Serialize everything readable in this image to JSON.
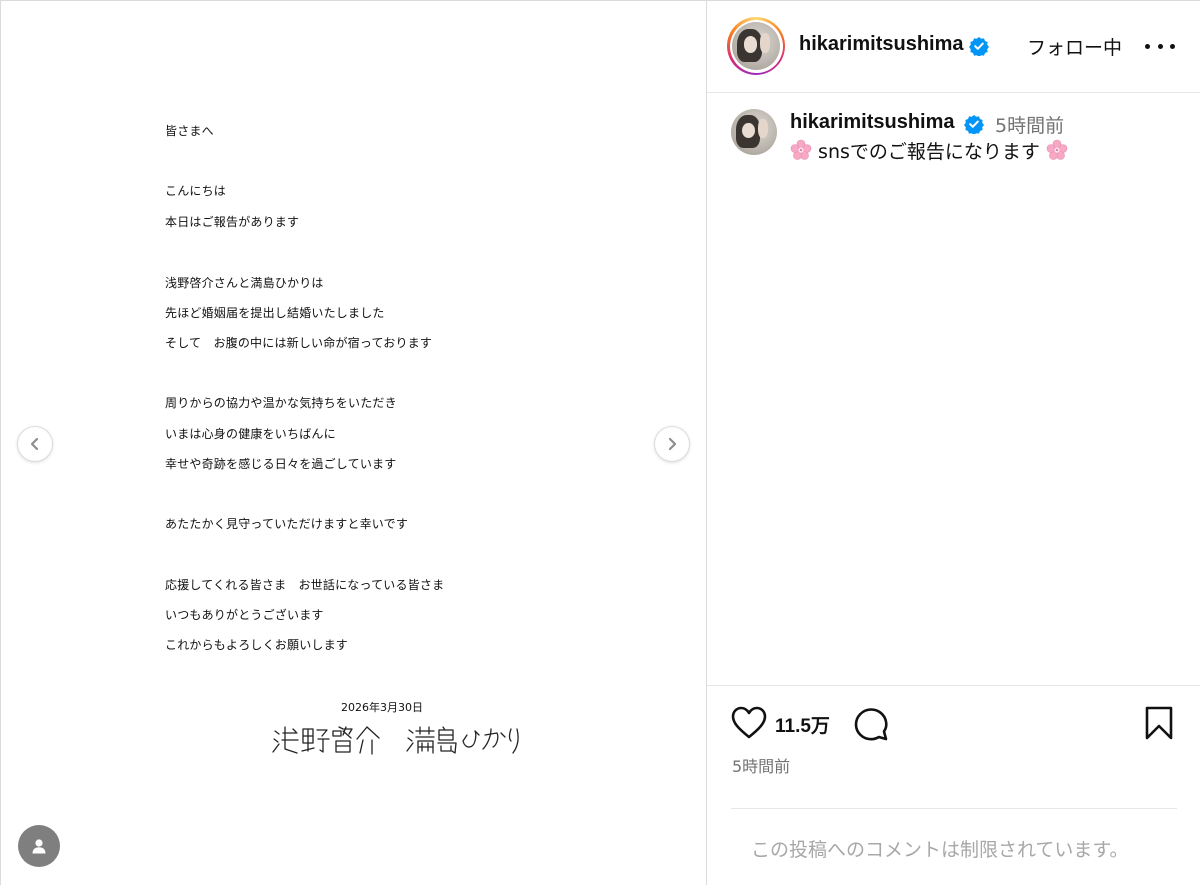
{
  "post": {
    "letter": {
      "lines": [
        "皆さまへ",
        "こんにちは",
        "本日はご報告があります",
        "浅野啓介さんと満島ひかりは",
        "先ほど婚姻届を提出し結婚いたしました",
        "そして　お腹の中には新しい命が宿っております",
        "周りからの協力や温かな気持ちをいただき",
        "いまは心身の健康をいちばんに",
        "幸せや奇跡を感じる日々を過ごしています",
        "あたたかく見守っていただけますと幸いです",
        "応援してくれる皆さま　お世話になっている皆さま",
        "いつもありがとうございます",
        "これからもよろしくお願いします"
      ],
      "date": "2026年3月30日",
      "signature": "浅野啓介　満島ひかり"
    },
    "nav": {
      "prev_icon": "chevron-left-icon",
      "next_icon": "chevron-right-icon"
    },
    "tag_icon": "person-icon"
  },
  "sidebar": {
    "header": {
      "username": "hikarimitsushima",
      "follow_label": "フォロー中",
      "more_icon": "more-horizontal-icon"
    },
    "caption": {
      "username": "hikarimitsushima",
      "time": "5時間前",
      "text": "snsでのご報告になります",
      "emoji": "cherry-blossom-icon"
    },
    "actions": {
      "likes": "11.5万",
      "time": "5時間前"
    },
    "comments_restricted": "この投稿へのコメントは制限されています。"
  },
  "colors": {
    "verified": "#0095f6",
    "secondary_text": "#737373",
    "muted_text": "#a8a8a8",
    "divider": "#dbdbdb"
  }
}
